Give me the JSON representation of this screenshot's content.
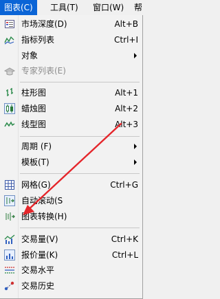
{
  "menubar": {
    "items": [
      "图表(C)",
      "工具(T)",
      "窗口(W)",
      "帮"
    ]
  },
  "menu": {
    "items": [
      {
        "label": "市场深度(D)",
        "shortcut": "Alt+B",
        "icon": "market-depth-icon"
      },
      {
        "label": "指标列表",
        "shortcut": "Ctrl+I",
        "icon": "indicator-list-icon"
      },
      {
        "label": "对象",
        "shortcut": "",
        "icon": ""
      },
      {
        "label": "专家列表(E)",
        "shortcut": "",
        "icon": "expert-hat-icon",
        "disabled": true
      },
      {
        "label": "柱形图",
        "shortcut": "Alt+1",
        "icon": "bar-chart-icon"
      },
      {
        "label": "蜡烛图",
        "shortcut": "Alt+2",
        "icon": "candlestick-icon"
      },
      {
        "label": "线型图",
        "shortcut": "Alt+3",
        "icon": "line-chart-icon"
      },
      {
        "label": "周期 (F)",
        "shortcut": "",
        "icon": ""
      },
      {
        "label": "模板(T)",
        "shortcut": "",
        "icon": ""
      },
      {
        "label": "网格(G)",
        "shortcut": "Ctrl+G",
        "icon": "grid-icon"
      },
      {
        "label": "自动滚动(S",
        "shortcut": "",
        "icon": "auto-scroll-icon"
      },
      {
        "label": "图表转换(H)",
        "shortcut": "",
        "icon": "chart-shift-icon"
      },
      {
        "label": "交易量(V)",
        "shortcut": "Ctrl+K",
        "icon": "volume-icon"
      },
      {
        "label": "报价量(K)",
        "shortcut": "Ctrl+L",
        "icon": "tick-volume-icon"
      },
      {
        "label": "交易水平",
        "shortcut": "",
        "icon": "trade-levels-icon"
      },
      {
        "label": "交易历史",
        "shortcut": "",
        "icon": "trade-history-icon"
      }
    ]
  },
  "colors": {
    "accent": "#0a64d6",
    "annotation_arrow": "#e5262b"
  }
}
